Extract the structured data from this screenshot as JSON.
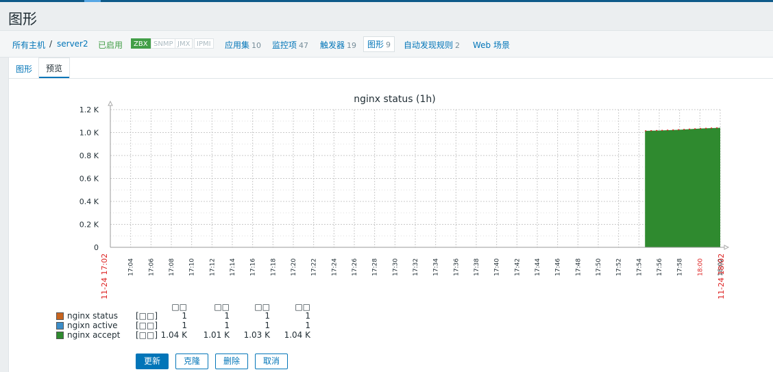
{
  "page": {
    "title": "图形"
  },
  "nav": {
    "all_hosts": "所有主机",
    "separator": "/",
    "host": "server2",
    "status": "已启用",
    "badges": [
      "ZBX",
      "SNMP",
      "JMX",
      "IPMI"
    ],
    "applications": {
      "label": "应用集",
      "count": "10"
    },
    "items": {
      "label": "监控项",
      "count": "47"
    },
    "triggers": {
      "label": "触发器",
      "count": "19"
    },
    "graphs": {
      "label": "图形",
      "count": "9"
    },
    "discovery": {
      "label": "自动发现规则",
      "count": "2"
    },
    "web": {
      "label": "Web 场景"
    }
  },
  "tabs": {
    "graph": "图形",
    "preview": "预览"
  },
  "chart_data": {
    "type": "area",
    "title": "nginx status (1h)",
    "y_ticks": [
      "1.2 K",
      "1.0 K",
      "0.8 K",
      "0.6 K",
      "0.4 K",
      "0.2 K",
      "0"
    ],
    "ylim": [
      0,
      1200
    ],
    "x_ticks": [
      "17:04",
      "17:06",
      "17:08",
      "17:10",
      "17:12",
      "17:14",
      "17:16",
      "17:18",
      "17:20",
      "17:22",
      "17:24",
      "17:26",
      "17:28",
      "17:30",
      "17:32",
      "17:34",
      "17:36",
      "17:38",
      "17:40",
      "17:42",
      "17:44",
      "17:46",
      "17:48",
      "17:50",
      "17:52",
      "17:54",
      "17:56",
      "17:58",
      "18:00",
      "18:02"
    ],
    "x_start_label": "11-24 17:02",
    "x_end_label": "11-24 18:02",
    "x_range_minutes": [
      0,
      60
    ],
    "series": [
      {
        "name": "nginx status",
        "color": "#c8641e",
        "points": [
          [
            52.6,
            1
          ],
          [
            60,
            1
          ]
        ]
      },
      {
        "name": "ngixn active",
        "color": "#3c8dc8",
        "points": [
          [
            52.6,
            1
          ],
          [
            60,
            1
          ]
        ]
      },
      {
        "name": "nginx accept",
        "color": "#2f8a2f",
        "points": [
          [
            52.6,
            1015
          ],
          [
            54,
            1018
          ],
          [
            56,
            1025
          ],
          [
            58,
            1035
          ],
          [
            60,
            1042
          ]
        ]
      }
    ],
    "threshold_color": "#dd2222"
  },
  "legend": {
    "headers": [
      "□□",
      "□□",
      "□□",
      "□□"
    ],
    "rows": [
      {
        "name": "nginx status",
        "color": "#c8641e",
        "func": "[□□]",
        "values": [
          "1",
          "1",
          "1",
          "1"
        ]
      },
      {
        "name": "ngixn active",
        "color": "#3c8dc8",
        "func": "[□□]",
        "values": [
          "1",
          "1",
          "1",
          "1"
        ]
      },
      {
        "name": "nginx accept",
        "color": "#2f8a2f",
        "func": "[□□]",
        "values": [
          "1.04 K",
          "1.01 K",
          "1.03 K",
          "1.04 K"
        ]
      }
    ]
  },
  "buttons": {
    "update": "更新",
    "clone": "克隆",
    "delete": "删除",
    "cancel": "取消"
  }
}
